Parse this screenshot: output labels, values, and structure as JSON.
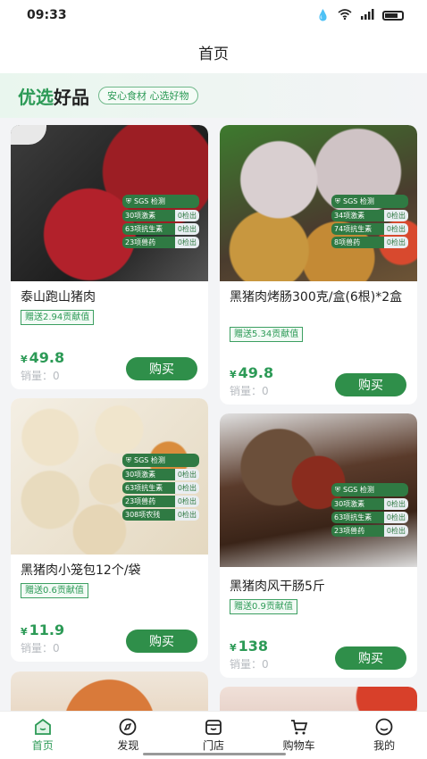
{
  "status": {
    "time": "09:33"
  },
  "header": {
    "title": "首页"
  },
  "banner": {
    "title_green": "优选",
    "title_dark": "好品",
    "tag": "安心食材 心选好物"
  },
  "sgs": {
    "label": "SGS 检测"
  },
  "products": [
    {
      "name": "泰山跑山猪肉",
      "gift": "赠送2.94贡献值",
      "price": "49.8",
      "sales": "销量：0",
      "buy": "购买",
      "tests": [
        [
          "30项激素",
          "0检出"
        ],
        [
          "63项抗生素",
          "0检出"
        ],
        [
          "23项兽药",
          "0检出"
        ]
      ]
    },
    {
      "name": "黑猪肉烤肠300克/盒(6根)*2盒",
      "gift": "赠送5.34贡献值",
      "price": "49.8",
      "sales": "销量：0",
      "buy": "购买",
      "tests": [
        [
          "34项激素",
          "0检出"
        ],
        [
          "74项抗生素",
          "0检出"
        ],
        [
          "8项兽药",
          "0检出"
        ]
      ]
    },
    {
      "name": "黑猪肉小笼包12个/袋",
      "gift": "赠送0.6贡献值",
      "price": "11.9",
      "sales": "销量：0",
      "buy": "购买",
      "tests": [
        [
          "30项激素",
          "0检出"
        ],
        [
          "63项抗生素",
          "0检出"
        ],
        [
          "23项兽药",
          "0检出"
        ],
        [
          "308项农残",
          "0检出"
        ]
      ]
    },
    {
      "name": "黑猪肉风干肠5斤",
      "gift": "赠送0.9贡献值",
      "price": "138",
      "sales": "销量：0",
      "buy": "购买",
      "tests": [
        [
          "30项激素",
          "0检出"
        ],
        [
          "63项抗生素",
          "0检出"
        ],
        [
          "23项兽药",
          "0检出"
        ]
      ]
    }
  ],
  "currency": "¥",
  "tabs": [
    {
      "label": "首页",
      "icon": "home-icon"
    },
    {
      "label": "发现",
      "icon": "compass-icon"
    },
    {
      "label": "门店",
      "icon": "store-icon"
    },
    {
      "label": "购物车",
      "icon": "cart-icon"
    },
    {
      "label": "我的",
      "icon": "profile-icon"
    }
  ],
  "colors": {
    "accent": "#2c9a56",
    "button": "#2f8f4a"
  }
}
